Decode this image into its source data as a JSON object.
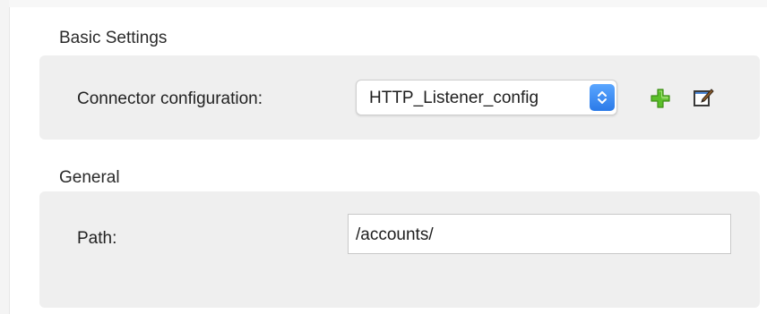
{
  "sections": {
    "basic_settings": {
      "title": "Basic Settings",
      "connector_configuration": {
        "label": "Connector configuration:",
        "selected_value": "HTTP_Listener_config",
        "dropdown_icon": "up-down-chevron-icon",
        "add_icon": "green-plus-icon",
        "edit_icon": "edit-pencil-icon"
      }
    },
    "general": {
      "title": "General",
      "path": {
        "label": "Path:",
        "value": "/accounts/"
      }
    }
  },
  "colors": {
    "panel_background": "#efefef",
    "select_accent": "#2b7ae8",
    "add_icon_green": "#5bbf2a"
  }
}
